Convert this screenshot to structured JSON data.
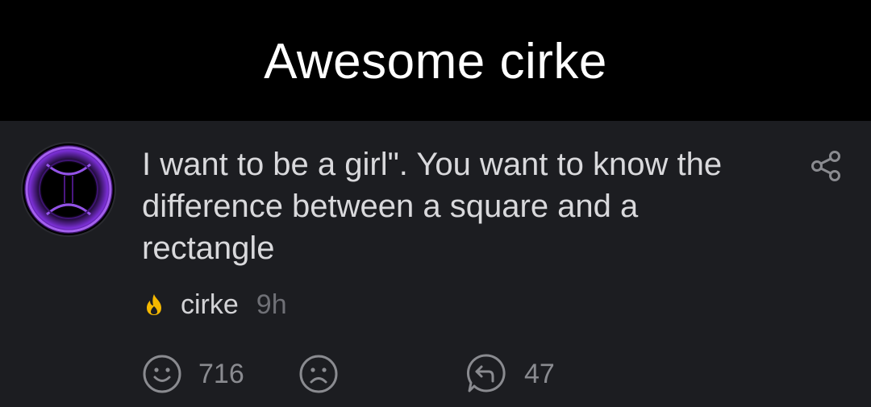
{
  "header": {
    "title": "Awesome cirke"
  },
  "post": {
    "avatar_icon": "portal-avatar-icon",
    "text": "I want to be a girl\". You want to know the difference between a square and a rectangle",
    "share_icon": "share-icon",
    "badge_icon": "fire-icon",
    "badge_color": "#f5b800",
    "author": "cirke",
    "time": "9h"
  },
  "actions": {
    "like_icon": "smiley-icon",
    "like_count": "716",
    "dislike_icon": "frown-icon",
    "reply_icon": "reply-icon",
    "reply_count": "47"
  }
}
